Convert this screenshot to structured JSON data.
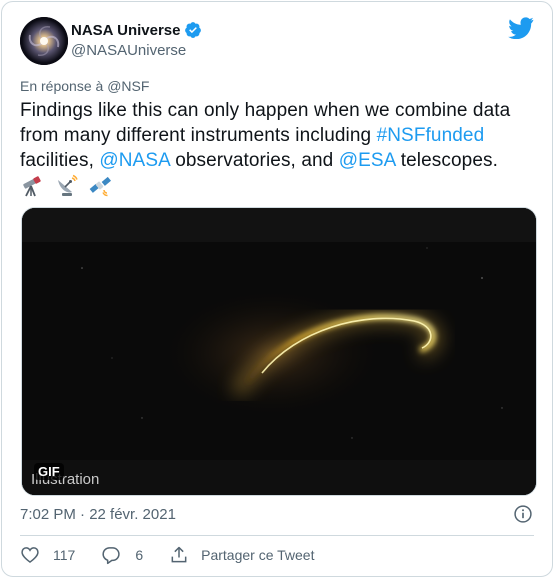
{
  "tweet": {
    "author": {
      "display_name": "NASA Universe",
      "handle": "@NASAUniverse",
      "verified": true,
      "avatar_icon": "galaxy-avatar"
    },
    "brand_icon": "twitter-bird-icon",
    "reply_prefix": "En réponse à",
    "reply_to": "@NSF",
    "text_parts": {
      "p1": "Findings like this can only happen when we combine data from many different instruments including ",
      "hashtag": "#NSFfunded",
      "p2": " facilities, ",
      "mention_nasa": "@NASA",
      "p3": " observatories, and ",
      "mention_esa": "@ESA",
      "p4": " telescopes."
    },
    "emojis": [
      "telescope-emoji",
      "satellite-antenna-emoji",
      "satellite-emoji"
    ],
    "media": {
      "badge": "GIF",
      "caption": "Illustration"
    },
    "timestamp": "7:02 PM · 22 févr. 2021",
    "actions": {
      "likes": "117",
      "replies": "6",
      "share_label": "Partager ce Tweet"
    }
  },
  "colors": {
    "link": "#1d9bf0",
    "secondary_text": "#536471",
    "border": "#cfd9de",
    "text": "#0f1419"
  }
}
